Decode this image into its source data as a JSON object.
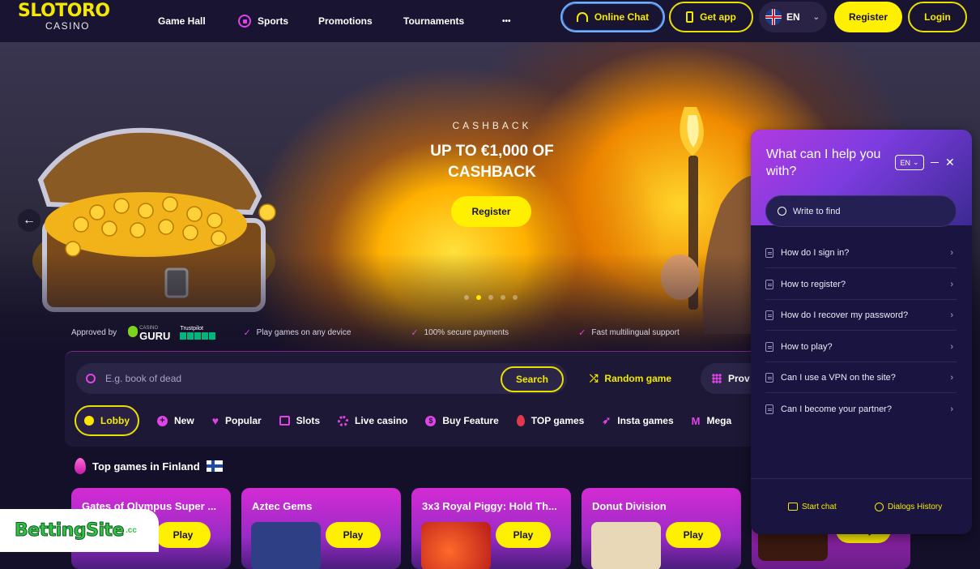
{
  "brand": {
    "name": "SLOTORO",
    "sub": "CASINO"
  },
  "nav": {
    "game_hall": "Game Hall",
    "sports": "Sports",
    "promotions": "Promotions",
    "tournaments": "Tournaments",
    "more": "•••"
  },
  "header": {
    "online_chat": "Online Chat",
    "get_app": "Get app",
    "lang": "EN",
    "register": "Register",
    "login": "Login"
  },
  "hero": {
    "label": "CASHBACK",
    "title": "UP TO €1,000 OF CASHBACK",
    "register": "Register",
    "slides": 5,
    "active_slide": 2
  },
  "features": {
    "approved_by": "Approved by",
    "guru": "GURU",
    "casino_small": "CASINO",
    "trustpilot": "Trustpilot",
    "f1": "Play games on any device",
    "f2": "100% secure payments",
    "f3": "Fast multilingual support"
  },
  "search": {
    "placeholder": "E.g. book of dead",
    "button": "Search",
    "random": "Random game",
    "providers": "Prov"
  },
  "categories": [
    "Lobby",
    "New",
    "Popular",
    "Slots",
    "Live casino",
    "Buy Feature",
    "TOP games",
    "Insta games",
    "Mega"
  ],
  "section": {
    "title": "Top games in Finland"
  },
  "games": [
    {
      "title": "Gates of Olympus Super ...",
      "play": "Play"
    },
    {
      "title": "Aztec Gems",
      "play": "Play"
    },
    {
      "title": "3x3 Royal Piggy: Hold Th...",
      "play": "Play"
    },
    {
      "title": "Donut Division",
      "play": "Play"
    },
    {
      "title": "",
      "play": "Play"
    }
  ],
  "watermark": {
    "text": "BettingSite",
    "tld": ".cc"
  },
  "chat": {
    "title": "What can I help you with?",
    "lang": "EN",
    "search_placeholder": "Write to find",
    "faqs": [
      "How do I sign in?",
      "How to register?",
      "How do I recover my password?",
      "How to play?",
      "Can I use a VPN on the site?",
      "Can I become your partner?"
    ],
    "start_chat": "Start chat",
    "history": "Dialogs History"
  },
  "colors": {
    "accent": "#ffef00",
    "bg": "#14102a",
    "chat_bg": "#1a1440",
    "magenta": "#e044e6"
  }
}
